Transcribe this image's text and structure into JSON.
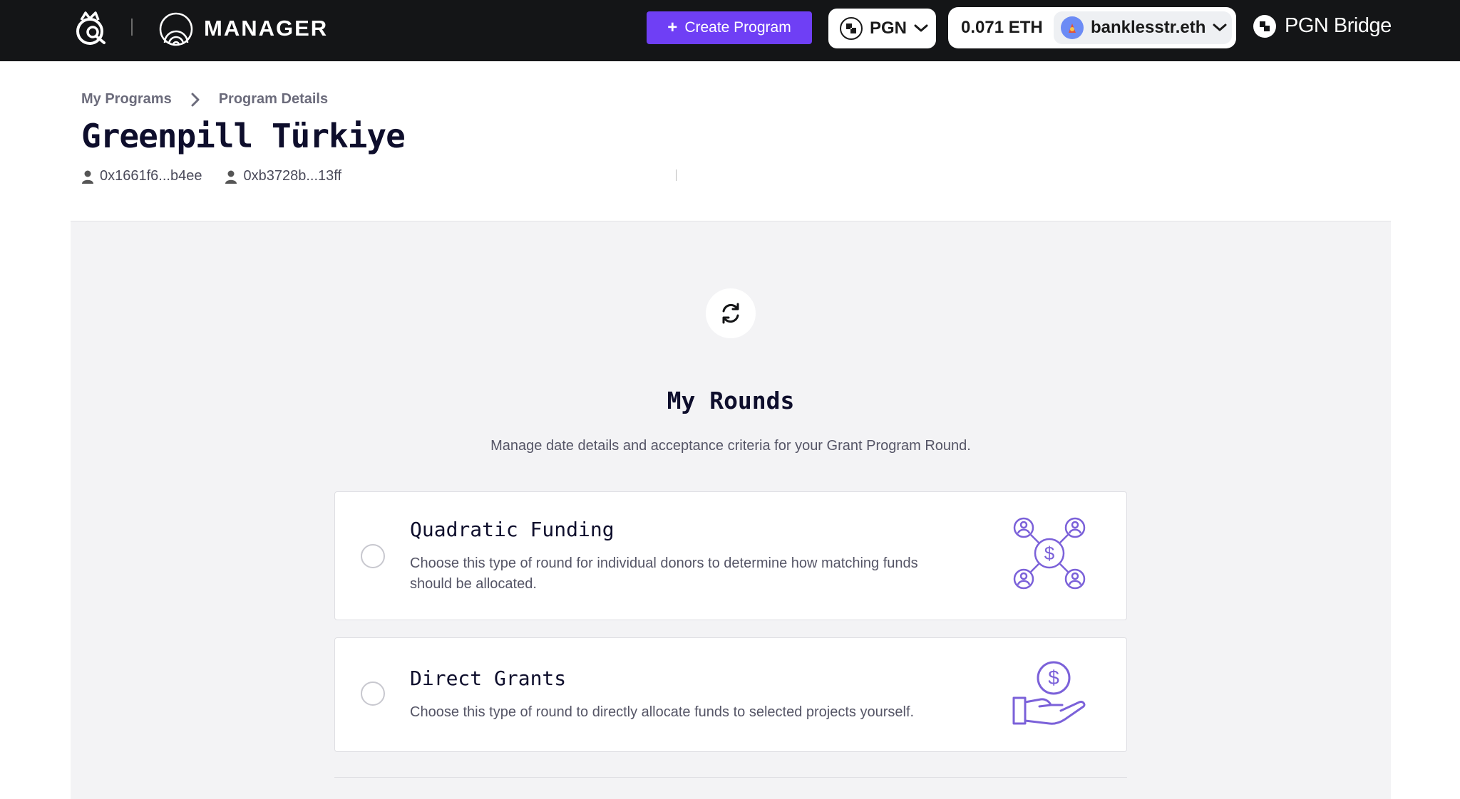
{
  "nav": {
    "manager_label": "MANAGER",
    "create_button": "Create Program",
    "chain_name": "PGN",
    "balance": "0.071 ETH",
    "ens_name": "banklesstr.eth",
    "bridge_label": "PGN Bridge"
  },
  "breadcrumb": {
    "items": [
      {
        "label": "My Programs"
      },
      {
        "label": "Program Details"
      }
    ]
  },
  "program": {
    "title": "Greenpill Türkiye",
    "owners": [
      {
        "address": "0x1661f6...b4ee"
      },
      {
        "address": "0xb3728b...13ff"
      }
    ]
  },
  "rounds": {
    "title": "My Rounds",
    "subtitle": "Manage date details and acceptance criteria for your Grant Program Round.",
    "options": [
      {
        "title": "Quadratic Funding",
        "description": "Choose this type of round for individual donors to determine how matching funds should be allocated.",
        "icon": "quadratic-funding-network-icon"
      },
      {
        "title": "Direct Grants",
        "description": "Choose this type of round to directly allocate funds to selected projects yourself.",
        "icon": "hand-dollar-icon"
      }
    ]
  },
  "colors": {
    "nav_bg": "#141517",
    "accent": "#6f3ff5",
    "illustration": "#7b61d9",
    "panel_bg": "#f3f3f5"
  }
}
